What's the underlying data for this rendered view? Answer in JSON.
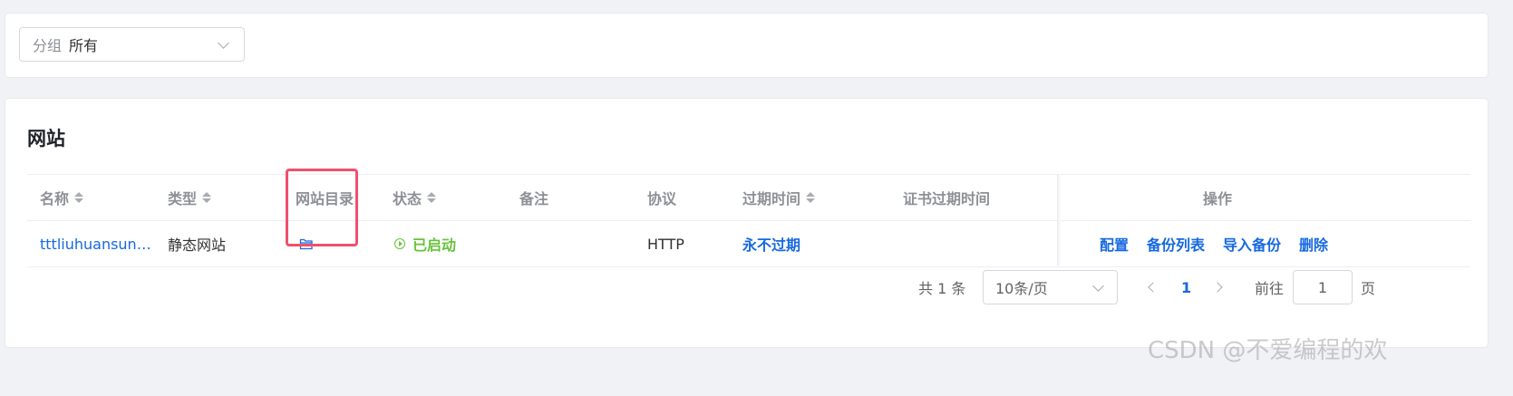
{
  "filter": {
    "group_prefix": "分组",
    "group_value": "所有"
  },
  "section_title": "网站",
  "table": {
    "headers": {
      "name": "名称",
      "type": "类型",
      "dir": "网站目录",
      "status": "状态",
      "remark": "备注",
      "protocol": "协议",
      "expire": "过期时间",
      "cert_expire": "证书过期时间",
      "ops": "操作"
    },
    "rows": [
      {
        "name": "tttliuhuansun…",
        "type": "静态网站",
        "status": "已启动",
        "remark": "",
        "protocol": "HTTP",
        "expire": "永不过期",
        "cert_expire": ""
      }
    ],
    "ops": [
      "配置",
      "备份列表",
      "导入备份",
      "删除"
    ]
  },
  "pagination": {
    "total": "共 1 条",
    "page_size": "10条/页",
    "current": "1",
    "goto_label": "前往",
    "goto_value": "1",
    "page_suffix": "页"
  },
  "watermark": "CSDN @不爱编程的欢",
  "colors": {
    "link": "#1769e0",
    "success": "#67c23a",
    "highlight": "#f0506e"
  }
}
